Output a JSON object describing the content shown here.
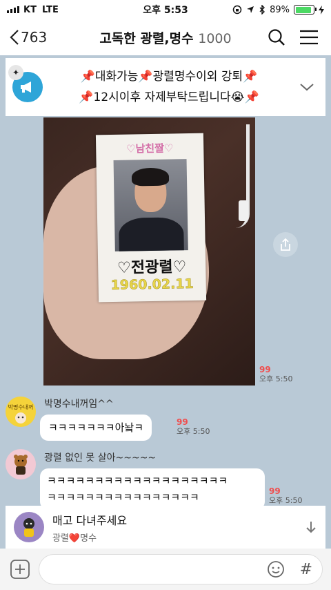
{
  "status_bar": {
    "carrier": "KT",
    "network": "LTE",
    "time": "오후 5:53",
    "battery_percent": "89%",
    "battery_level": 0.89,
    "battery_color": "#4cd964"
  },
  "header": {
    "back_count": "763",
    "title": "고독한 광렬,명수",
    "member_count": "1000",
    "search_icon": "search-icon",
    "menu_icon": "hamburger-menu-icon"
  },
  "notice": {
    "line1": "📌대화가능📌광렬명수이외 강퇴📌",
    "line2": "📌12시이후 자제부탁드립니다😭📌",
    "icon": "megaphone-icon",
    "pin_icon": "pin-icon",
    "expand_icon": "chevron-down-icon"
  },
  "photo_message": {
    "card_top": "♡남친짤♡",
    "card_name": "♡전광렬♡",
    "card_date": "1960.02.11",
    "unread": "99",
    "time": "오후 5:50"
  },
  "messages": [
    {
      "sender": "박명수내꺼임^^",
      "avatar_label": "박명수내꺼",
      "text": "ㅋㅋㅋㅋㅋㅋㅋ아놬ㅋ",
      "unread": "99",
      "time": "오후 5:50"
    },
    {
      "sender": "광렬 없인 못 살아~~~~~",
      "line1": "ㅋㅋㅋㅋㅋㅋㅋㅋㅋㅋㅋㅋㅋㅋㅋㅋㅋㅋㅋ",
      "line2": "ㅋㅋㅋㅋㅋㅋㅋㅋㅋㅋㅋㅋㅋㅋㅋㅋ",
      "unread": "99",
      "time": "오후 5:50"
    }
  ],
  "pinned_quote": {
    "message": "매고 다녀주세요",
    "sub_prefix": "광렬",
    "sub_heart": "❤️",
    "sub_suffix": "명수",
    "icon": "arrow-down-icon"
  },
  "input_bar": {
    "plus_icon": "plus-icon",
    "emoji_icon": "emoji-icon",
    "hash_label": "#"
  }
}
